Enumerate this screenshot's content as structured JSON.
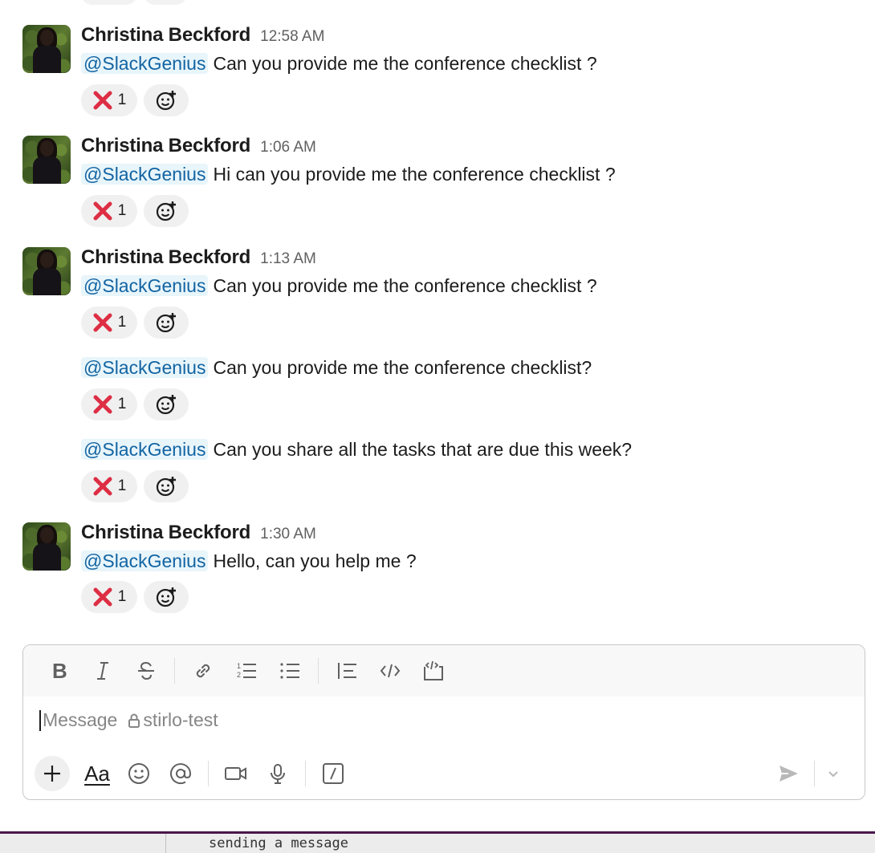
{
  "messages": [
    {
      "author": "Christina Beckford",
      "time": "12:58 AM",
      "lines": [
        {
          "mention": "@SlackGenius",
          "text": "Can you provide me the conference checklist ?",
          "reaction_count": "1"
        }
      ]
    },
    {
      "author": "Christina Beckford",
      "time": "1:06 AM",
      "lines": [
        {
          "mention": "@SlackGenius",
          "text": "Hi can you provide me the conference checklist ?",
          "reaction_count": "1"
        }
      ]
    },
    {
      "author": "Christina Beckford",
      "time": "1:13 AM",
      "lines": [
        {
          "mention": "@SlackGenius",
          "text": "Can you provide me the conference checklist ?",
          "reaction_count": "1"
        },
        {
          "mention": "@SlackGenius",
          "text": "Can you provide me the conference checklist?",
          "reaction_count": "1"
        },
        {
          "mention": "@SlackGenius",
          "text": "Can you share all the tasks that are due this week?",
          "reaction_count": "1"
        }
      ]
    },
    {
      "author": "Christina Beckford",
      "time": "1:30 AM",
      "lines": [
        {
          "mention": "@SlackGenius",
          "text": "Hello, can you help me ?",
          "reaction_count": "1"
        }
      ]
    }
  ],
  "reaction_emoji": "cross-mark-icon",
  "composer": {
    "placeholder": "Message",
    "channel": "stirlo-test",
    "format_aa": "Aa",
    "format_icons": [
      "bold-icon",
      "italic-icon",
      "strikethrough-icon",
      "link-icon",
      "ordered-list-icon",
      "bullet-list-icon",
      "blockquote-icon",
      "code-icon",
      "code-block-icon"
    ],
    "bottom_icons": [
      "plus-icon",
      "formatting-icon",
      "emoji-icon",
      "mention-icon",
      "video-icon",
      "microphone-icon",
      "slash-command-icon",
      "send-icon",
      "chevron-down-icon"
    ]
  },
  "status_bar": {
    "text": "sending a message"
  },
  "colors": {
    "mention_text": "#1264a3",
    "mention_bg": "#e8f5fa",
    "reaction_bg": "#f0f0f0",
    "footer_accent": "#4a154b",
    "cross_mark": "#dd2e44"
  }
}
